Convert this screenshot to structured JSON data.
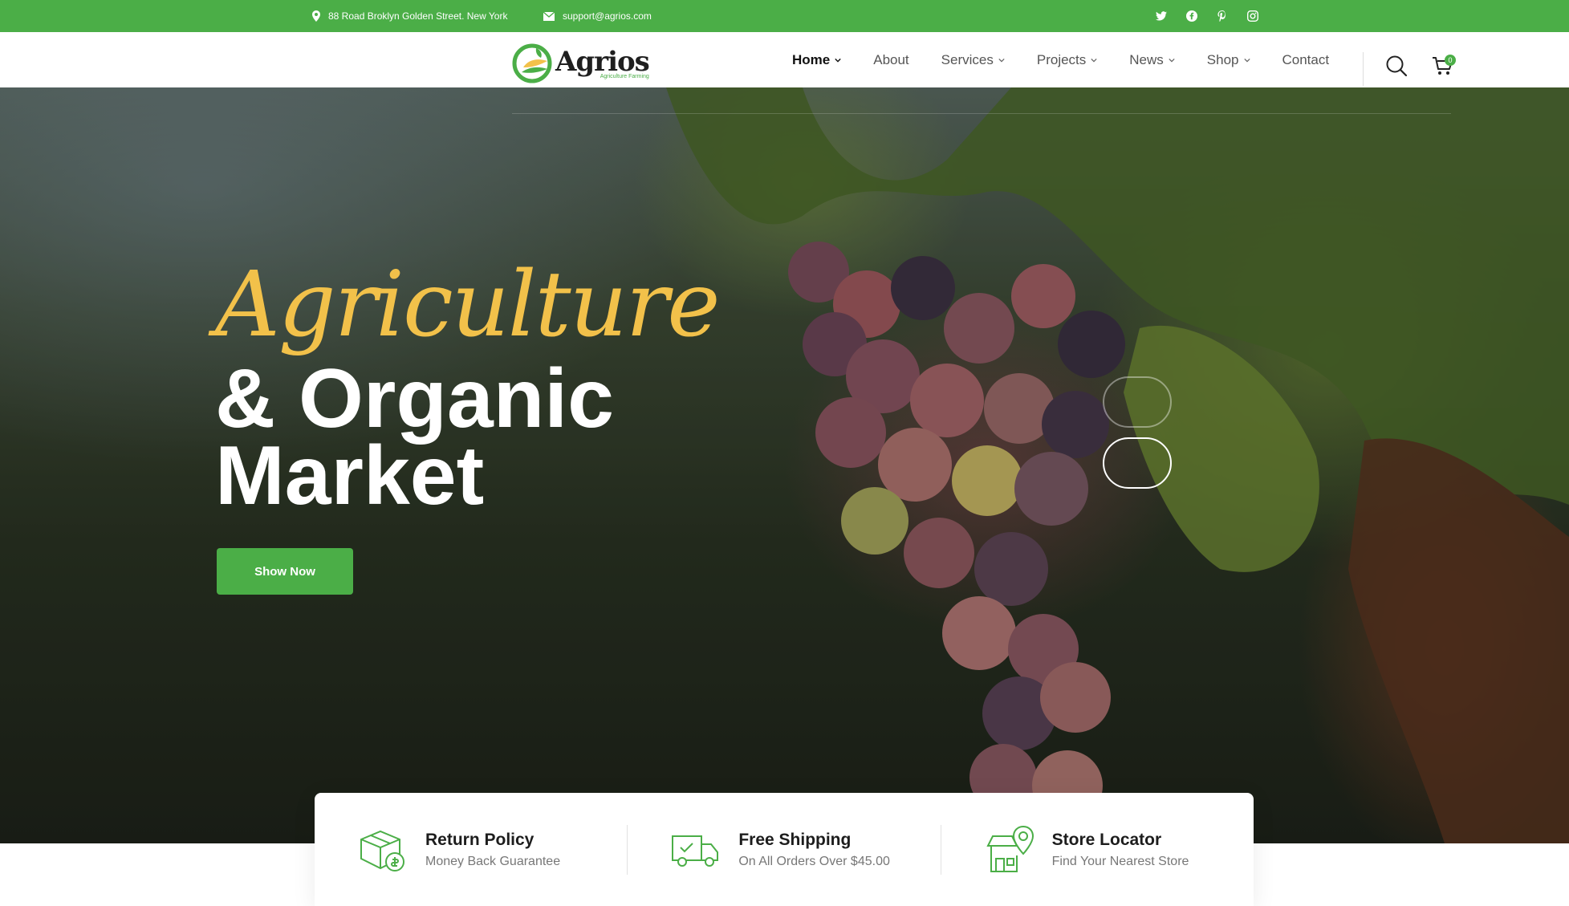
{
  "topbar": {
    "address": "88 Road Broklyn Golden Street. New York",
    "email": "support@agrios.com",
    "social": [
      "twitter-icon",
      "facebook-icon",
      "pinterest-icon",
      "instagram-icon"
    ]
  },
  "header": {
    "logo_name": "Agrios",
    "logo_tagline": "Agriculture Farming",
    "nav": {
      "home": "Home",
      "about": "About",
      "services": "Services",
      "projects": "Projects",
      "news": "News",
      "shop": "Shop",
      "contact": "Contact"
    },
    "cart_count": "0"
  },
  "hero": {
    "script": "Agriculture",
    "title_line1": "& Organic",
    "title_line2": "Market",
    "button": "Show Now"
  },
  "features": [
    {
      "title": "Return Policy",
      "subtitle": "Money Back Guarantee",
      "icon": "box-return-icon"
    },
    {
      "title": "Free Shipping",
      "subtitle": "On All Orders Over $45.00",
      "icon": "delivery-truck-icon"
    },
    {
      "title": "Store Locator",
      "subtitle": "Find Your Nearest Store",
      "icon": "store-location-icon"
    }
  ],
  "colors": {
    "brand_green": "#4bae47",
    "accent_yellow": "#f2c14a",
    "text_dark": "#1d1d1d"
  }
}
